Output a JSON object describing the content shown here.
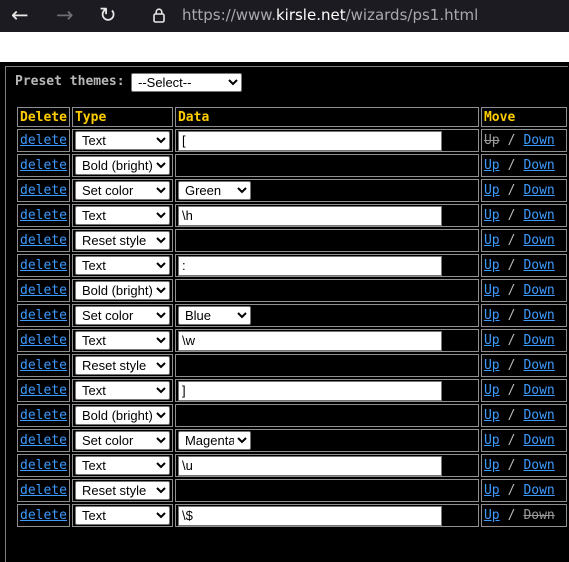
{
  "browser": {
    "url_prefix": "https://www.",
    "url_host": "kirsle.net",
    "url_path": "/wizards/ps1.html"
  },
  "preset": {
    "label": "Preset themes:",
    "selected": "--Select--"
  },
  "table": {
    "headers": [
      "Delete",
      "Type",
      "Data",
      "Move"
    ],
    "delete_label": "delete",
    "up_label": "Up",
    "down_label": "Down",
    "sep": "/",
    "rows": [
      {
        "type": "Text",
        "data": "[",
        "up_disabled": true,
        "down_disabled": false
      },
      {
        "type": "Bold (bright)",
        "data": null
      },
      {
        "type": "Set color",
        "color": "Green"
      },
      {
        "type": "Text",
        "data": "\\h"
      },
      {
        "type": "Reset style",
        "data": null
      },
      {
        "type": "Text",
        "data": ":"
      },
      {
        "type": "Bold (bright)",
        "data": null
      },
      {
        "type": "Set color",
        "color": "Blue"
      },
      {
        "type": "Text",
        "data": "\\w"
      },
      {
        "type": "Reset style",
        "data": null
      },
      {
        "type": "Text",
        "data": "]"
      },
      {
        "type": "Bold (bright)",
        "data": null
      },
      {
        "type": "Set color",
        "color": "Magenta"
      },
      {
        "type": "Text",
        "data": "\\u"
      },
      {
        "type": "Reset style",
        "data": null
      },
      {
        "type": "Text",
        "data": "\\$",
        "up_disabled": false,
        "down_disabled": true
      }
    ]
  }
}
